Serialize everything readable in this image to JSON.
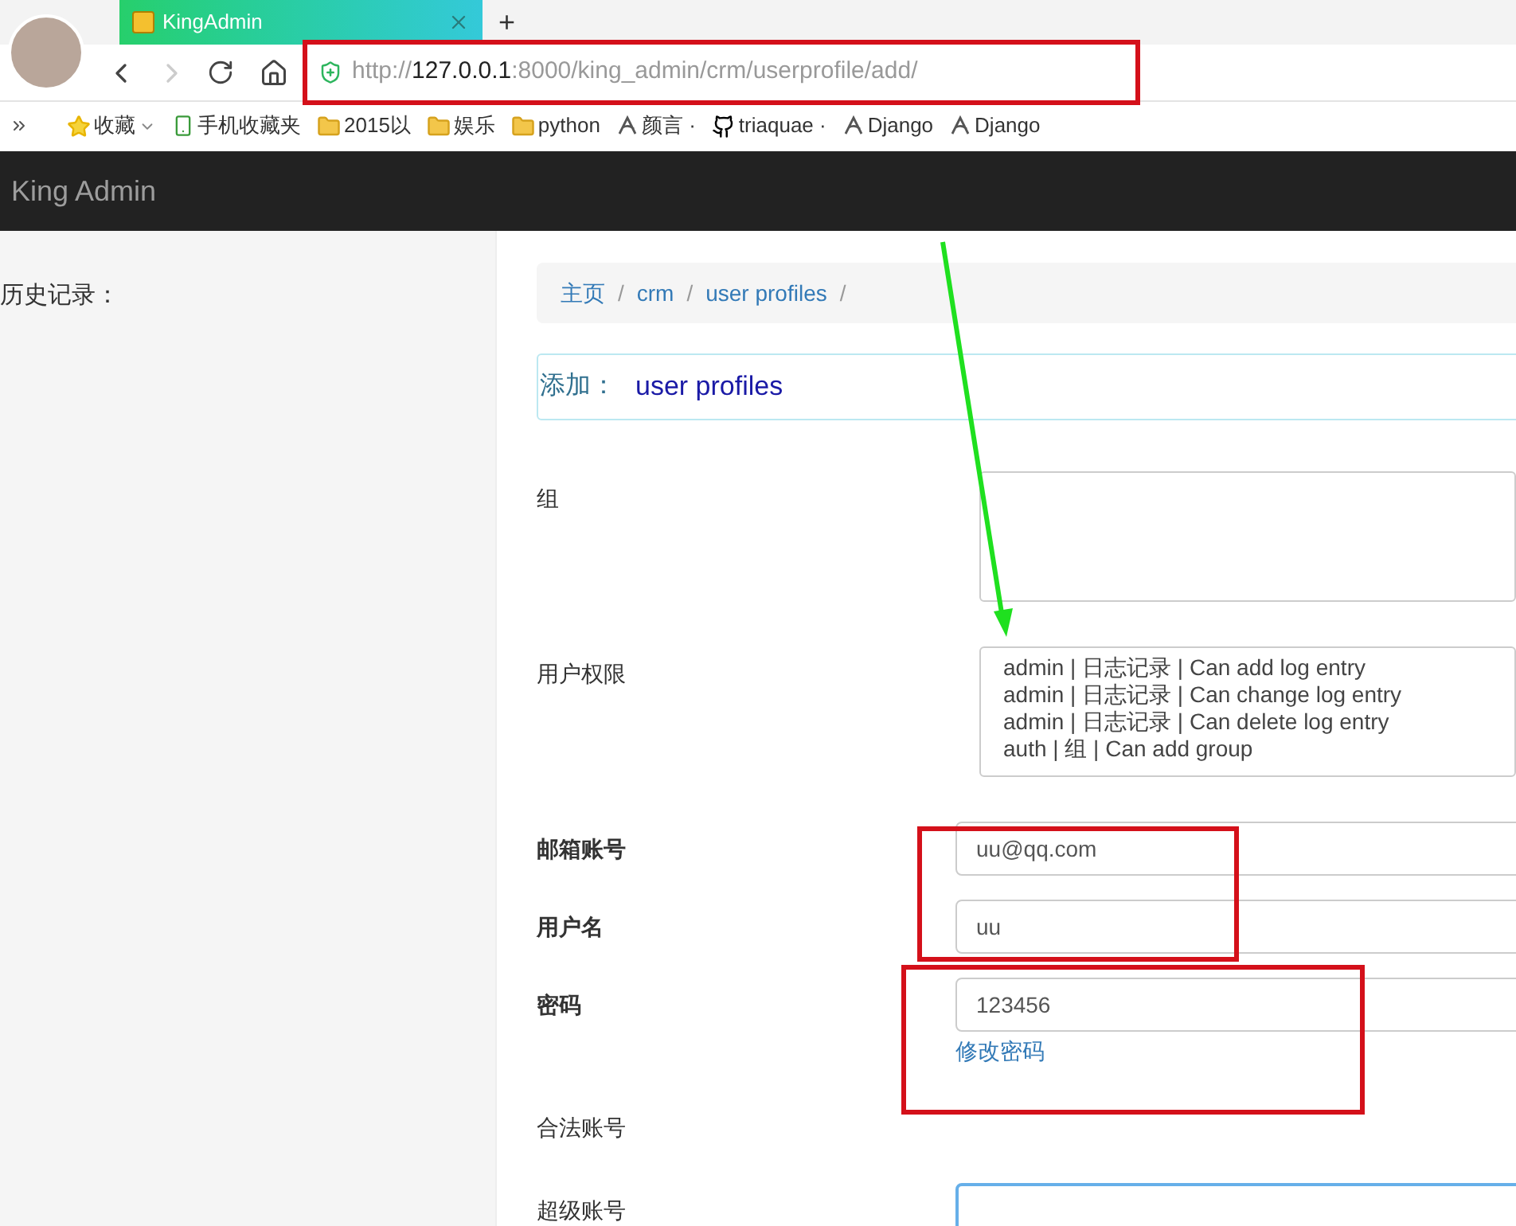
{
  "browser": {
    "tab": {
      "title": "KingAdmin",
      "selected": true
    },
    "new_tab": "+",
    "url": {
      "scheme": "http://",
      "host": "127.0.0.1",
      "path": ":8000/king_admin/crm/userprofile/add/"
    },
    "bookmarks": [
      {
        "kind": "star",
        "label": "收藏",
        "dropdown": true
      },
      {
        "kind": "phone",
        "label": "手机收藏夹",
        "dropdown": false
      },
      {
        "kind": "folder",
        "label": "2015以",
        "dropdown": false
      },
      {
        "kind": "folder",
        "label": "娱乐",
        "dropdown": false
      },
      {
        "kind": "folder",
        "label": "python",
        "dropdown": false
      },
      {
        "kind": "logo",
        "label": "颜言 ·",
        "dropdown": false
      },
      {
        "kind": "github",
        "label": "triaquae ·",
        "dropdown": false
      },
      {
        "kind": "logo",
        "label": "Django",
        "dropdown": false
      },
      {
        "kind": "logo",
        "label": "Django",
        "dropdown": false
      }
    ]
  },
  "navbar": {
    "brand": "King Admin"
  },
  "sidebar": {
    "title": "历史记录："
  },
  "breadcrumb": [
    {
      "label": "主页",
      "separator": "/"
    },
    {
      "label": "crm",
      "separator": "/"
    },
    {
      "label": "user profiles",
      "separator": "/"
    }
  ],
  "panel": {
    "prefix": "添加：",
    "title": "user profiles"
  },
  "fields": [
    {
      "kind": "multiselect",
      "label": "组",
      "required": false
    },
    {
      "kind": "multiselect",
      "label": "用户权限",
      "required": false,
      "options": [
        "admin | 日志记录 | Can add log entry",
        "admin | 日志记录 | Can change log entry",
        "admin | 日志记录 | Can delete log entry",
        "auth | 组 | Can add group"
      ]
    },
    {
      "kind": "text",
      "label": "邮箱账号",
      "required": true,
      "value": "uu@qq.com",
      "focused": false
    },
    {
      "kind": "text",
      "label": "用户名",
      "required": true,
      "value": "uu",
      "focused": false
    },
    {
      "kind": "text",
      "label": "密码",
      "required": true,
      "value": "123456",
      "focused": false,
      "link": "修改密码"
    },
    {
      "kind": "blank",
      "label": "合法账号",
      "required": false
    },
    {
      "kind": "text",
      "label": "超级账号",
      "required": false,
      "focused": true
    }
  ]
}
